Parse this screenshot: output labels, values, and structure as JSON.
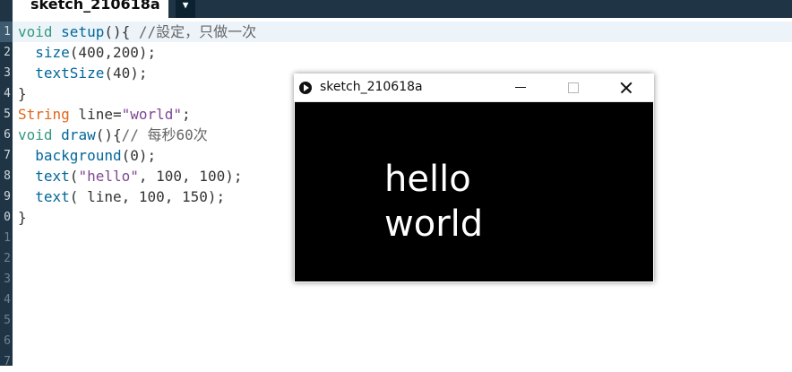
{
  "tab": {
    "title": "sketch_210618a",
    "menu_glyph": "▼"
  },
  "gutter": {
    "line_numbers": [
      "1",
      "2",
      "3",
      "4",
      "5",
      "6",
      "7",
      "8",
      "9",
      "0",
      "1",
      "2",
      "3",
      "4",
      "5",
      "6",
      "7"
    ]
  },
  "code": {
    "l1": {
      "kw": "void",
      "fn": "setup",
      "rest": "(){ ",
      "comment": "//設定，只做一次"
    },
    "l2": {
      "fn": "size",
      "rest": "(400,200);"
    },
    "l3": {
      "fn": "textSize",
      "rest": "(40);"
    },
    "l4": {
      "rest": "}"
    },
    "l5": {
      "type": "String",
      "rest": " line=",
      "str": "\"world\"",
      "end": ";"
    },
    "l6": {
      "kw": "void",
      "fn": "draw",
      "rest": "(){",
      "comment": "// 每秒60次"
    },
    "l7": {
      "fn": "background",
      "rest": "(0);"
    },
    "l8": {
      "fn": "text",
      "rest1": "(",
      "str": "\"hello\"",
      "rest2": ", 100, 100);"
    },
    "l9": {
      "fn": "text",
      "rest": "( line, 100, 150);"
    },
    "l10": {
      "rest": "}"
    }
  },
  "sketch_window": {
    "title": "sketch_210618a",
    "text1": "hello",
    "text2": "world"
  }
}
